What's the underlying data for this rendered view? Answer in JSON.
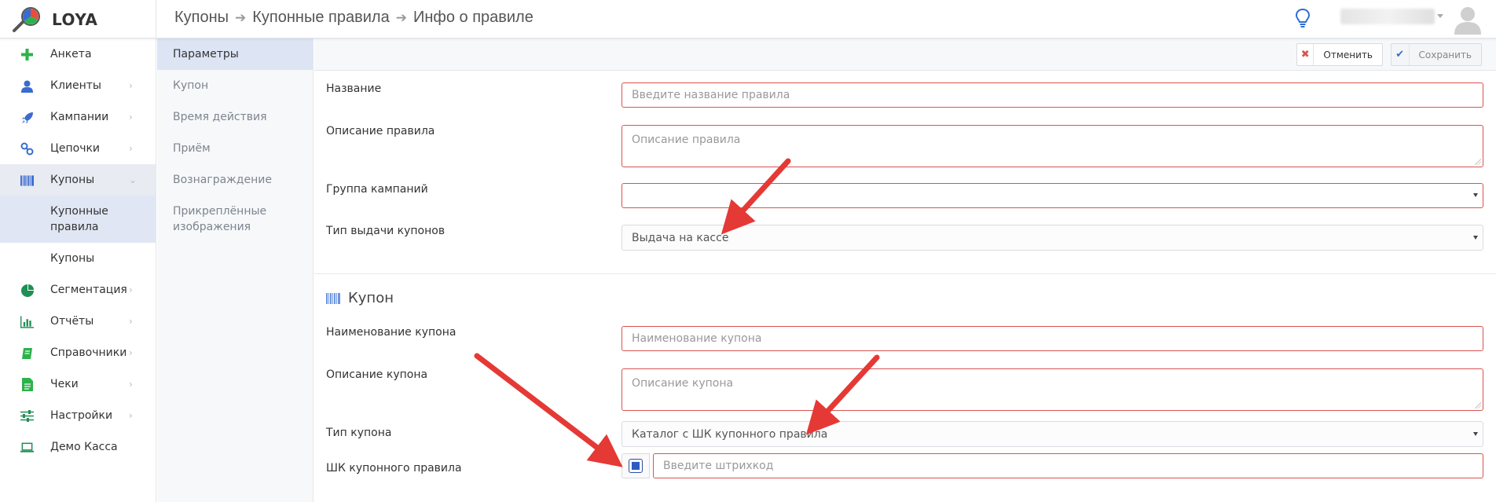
{
  "app": {
    "brand": "LOYA"
  },
  "breadcrumb": [
    "Купоны",
    "Купонные правила",
    "Инфо о правиле"
  ],
  "sidebar": {
    "items": [
      {
        "label": "Анкета",
        "icon": "plus-icon",
        "color": "#2bb34a"
      },
      {
        "label": "Клиенты",
        "icon": "user-icon",
        "color": "#3a6bd1"
      },
      {
        "label": "Кампании",
        "icon": "rocket-icon",
        "color": "#3a6bd1"
      },
      {
        "label": "Цепочки",
        "icon": "chain-icon",
        "color": "#3a6bd1"
      },
      {
        "label": "Купоны",
        "icon": "barcode-icon",
        "color": "#3a6bd1"
      },
      {
        "label": "Купонные правила"
      },
      {
        "label": "Купоны"
      },
      {
        "label": "Сегментация",
        "icon": "pie-icon",
        "color": "#1f8f55"
      },
      {
        "label": "Отчёты",
        "icon": "bar-chart-icon",
        "color": "#1f8f55"
      },
      {
        "label": "Справочники",
        "icon": "book-icon",
        "color": "#2bb34a"
      },
      {
        "label": "Чеки",
        "icon": "receipt-icon",
        "color": "#2bb34a"
      },
      {
        "label": "Настройки",
        "icon": "sliders-icon",
        "color": "#1f8f55"
      },
      {
        "label": "Демо Касса",
        "icon": "laptop-icon",
        "color": "#1f8f55"
      }
    ]
  },
  "section_nav": [
    "Параметры",
    "Купон",
    "Время действия",
    "Приём",
    "Вознаграждение",
    "Прикреплённые изображения"
  ],
  "toolbar": {
    "cancel_label": "Отменить",
    "save_label": "Сохранить"
  },
  "form": {
    "name": {
      "label": "Название",
      "placeholder": "Введите название правила"
    },
    "description": {
      "label": "Описание правила",
      "placeholder": "Описание правила"
    },
    "campaign_group": {
      "label": "Группа кампаний",
      "value": ""
    },
    "issue_type": {
      "label": "Тип выдачи купонов",
      "value": "Выдача на кассе"
    },
    "coupon_section": {
      "title": "Купон"
    },
    "coupon_name": {
      "label": "Наименование купона",
      "placeholder": "Наименование купона"
    },
    "coupon_description": {
      "label": "Описание купона",
      "placeholder": "Описание купона"
    },
    "coupon_type": {
      "label": "Тип купона",
      "value": "Каталог с ШК купонного правила"
    },
    "barcode": {
      "label": "ШК купонного правила",
      "placeholder": "Введите штрихкод"
    }
  },
  "colors": {
    "accent": "#3a6bd1",
    "error_border": "#d9534f",
    "arrow": "#e53935"
  }
}
